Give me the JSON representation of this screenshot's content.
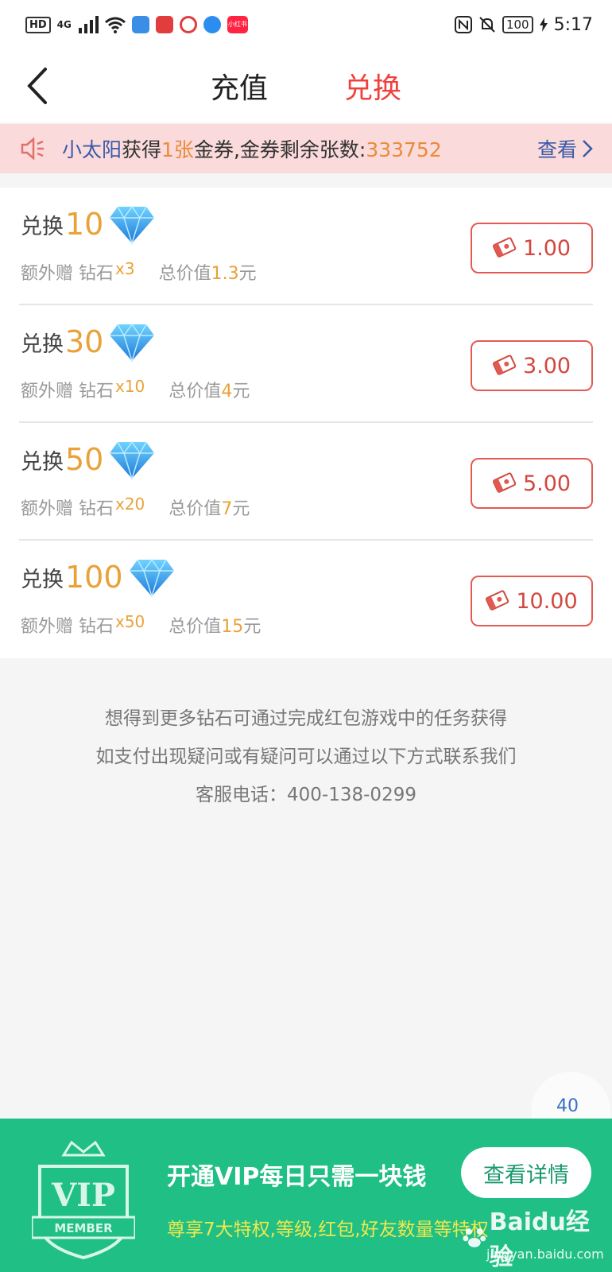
{
  "status_bar": {
    "hd": "HD",
    "network": "4G",
    "battery": "100",
    "time": "5:17",
    "xhs": "小红书"
  },
  "header": {
    "tabs": [
      {
        "label": "充值",
        "active": false
      },
      {
        "label": "兑换",
        "active": true
      }
    ]
  },
  "notice": {
    "user": "小太阳",
    "got": "获得",
    "count": "1张",
    "suffix": "金券,金券剩余张数:",
    "remaining": "333752",
    "view": "查看"
  },
  "items": [
    {
      "label": "兑换",
      "amount": "10",
      "bonus_label": "额外赠 钻石",
      "bonus": "x3",
      "total_label": "总价值",
      "total": "1.3",
      "unit": "元",
      "price": "1.00"
    },
    {
      "label": "兑换",
      "amount": "30",
      "bonus_label": "额外赠 钻石",
      "bonus": "x10",
      "total_label": "总价值",
      "total": "4",
      "unit": "元",
      "price": "3.00"
    },
    {
      "label": "兑换",
      "amount": "50",
      "bonus_label": "额外赠 钻石",
      "bonus": "x20",
      "total_label": "总价值",
      "total": "7",
      "unit": "元",
      "price": "5.00"
    },
    {
      "label": "兑换",
      "amount": "100",
      "bonus_label": "额外赠 钻石",
      "bonus": "x50",
      "total_label": "总价值",
      "total": "15",
      "unit": "元",
      "price": "10.00"
    }
  ],
  "info": {
    "line1": "想得到更多钻石可通过完成红包游戏中的任务获得",
    "line2": "如支付出现疑问或有疑问可以通过以下方式联系我们",
    "line3": "客服电话：400-138-0299"
  },
  "float": {
    "count": "40"
  },
  "vip": {
    "logo_text": "VIP",
    "logo_sub": "MEMBER",
    "title": "开通VIP每日只需一块钱",
    "subtitle": "尊享7大特权,等级,红包,好友数量等特权",
    "button": "查看详情"
  },
  "watermark": {
    "brand": "Baidu经验",
    "url": "jingyan.baidu.com"
  },
  "colors": {
    "accent": "#f0413c",
    "orange": "#e9a23a",
    "vip_green": "#1fbf86",
    "notice_bg": "#fadada"
  }
}
